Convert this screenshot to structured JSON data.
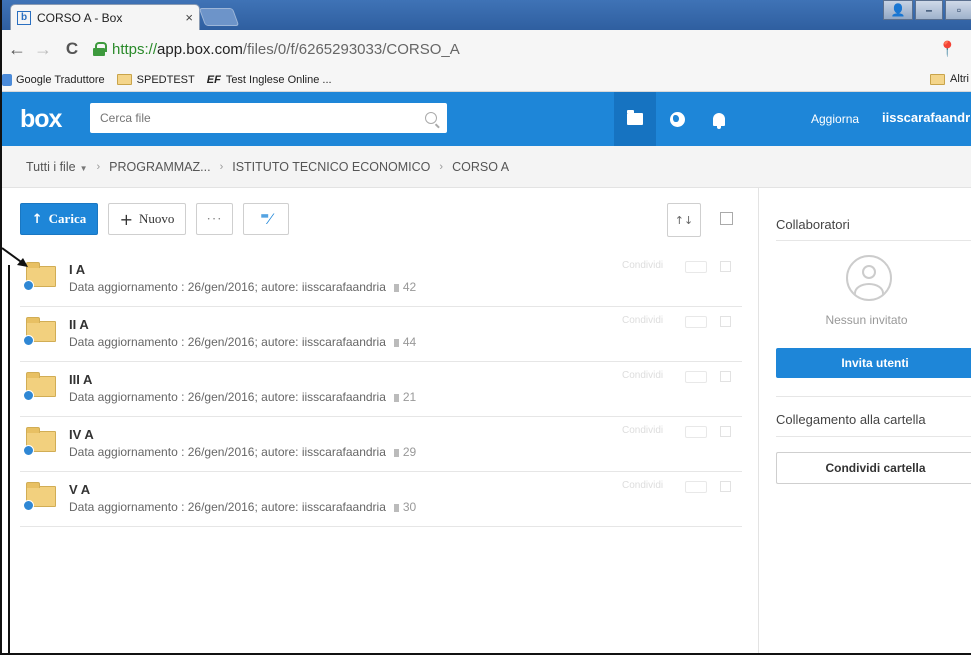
{
  "browser": {
    "tab_title": "CORSO A - Box",
    "tab_close": "×",
    "favicon": "b",
    "url_scheme": "https://",
    "url_host": "app.box.com",
    "url_path": "/files/0/f/6265293033/CORSO_A",
    "bookmarks": [
      {
        "label": "Google Traduttore",
        "icon": "translate-icon"
      },
      {
        "label": "SPEDTEST",
        "icon": "folder-icon"
      },
      {
        "label": "Test Inglese Online ...",
        "icon": "ef-icon",
        "prefix": "EF"
      }
    ],
    "other_bookmarks": "Altri"
  },
  "header": {
    "logo": "box",
    "search_placeholder": "Cerca file",
    "upgrade": "Aggiorna",
    "username": "iisscarafaandria",
    "brand_color": "#1e86d8"
  },
  "breadcrumb": {
    "root": "Tutti i file",
    "items": [
      "PROGRAMMAZ...",
      "ISTITUTO TECNICO ECONOMICO",
      "CORSO A"
    ],
    "separator": "›"
  },
  "toolbar": {
    "upload": "Carica",
    "new": "Nuovo",
    "more": "···",
    "notes": "⁼⁄"
  },
  "files": [
    {
      "name": "I A",
      "meta": "Data aggiornamento : 26/gen/2016; autore: iisscarafaandria",
      "count": "42",
      "share": "Condividi"
    },
    {
      "name": "II A",
      "meta": "Data aggiornamento : 26/gen/2016; autore: iisscarafaandria",
      "count": "44",
      "share": "Condividi"
    },
    {
      "name": "III A",
      "meta": "Data aggiornamento : 26/gen/2016; autore: iisscarafaandria",
      "count": "21",
      "share": "Condividi"
    },
    {
      "name": "IV A",
      "meta": "Data aggiornamento : 26/gen/2016; autore: iisscarafaandria",
      "count": "29",
      "share": "Condividi"
    },
    {
      "name": "V A",
      "meta": "Data aggiornamento : 26/gen/2016; autore: iisscarafaandria",
      "count": "30",
      "share": "Condividi"
    }
  ],
  "sidebar": {
    "collaborators_title": "Collaboratori",
    "no_invited": "Nessun invitato",
    "invite_button": "Invita utenti",
    "folder_link_title": "Collegamento alla cartella",
    "share_folder_button": "Condividi cartella"
  }
}
